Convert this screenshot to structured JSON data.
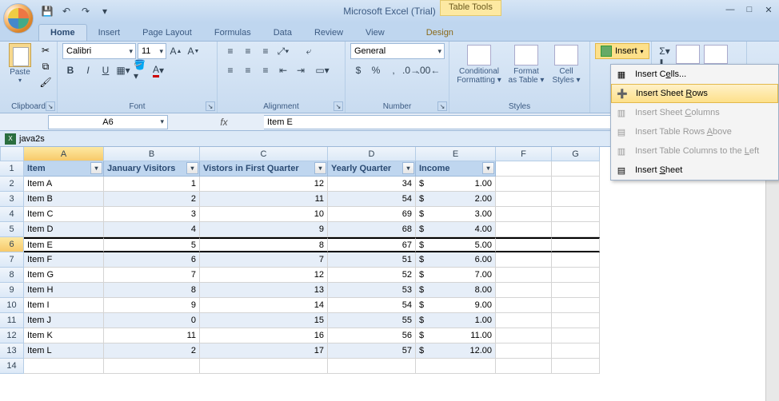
{
  "title": "Microsoft Excel (Trial)",
  "context_tab": "Table Tools",
  "tabs": [
    "Home",
    "Insert",
    "Page Layout",
    "Formulas",
    "Data",
    "Review",
    "View",
    "Design"
  ],
  "active_tab": "Home",
  "qat": {
    "save": "save",
    "undo": "↶",
    "redo": "↷"
  },
  "clipboard": {
    "paste": "Paste",
    "label": "Clipboard"
  },
  "font": {
    "name": "Calibri",
    "size": "11",
    "grow": "A",
    "shrink": "A",
    "bold": "B",
    "italic": "I",
    "underline": "U",
    "label": "Font"
  },
  "align": {
    "label": "Alignment"
  },
  "number": {
    "format": "General",
    "label": "Number",
    "currency": "$",
    "percent": "%",
    "comma": ","
  },
  "styles": {
    "cond": "Conditional",
    "cond2": "Formatting",
    "fmt": "Format",
    "fmt2": "as Table",
    "cell": "Cell",
    "cell2": "Styles",
    "label": "Styles"
  },
  "cells": {
    "insert": "Insert"
  },
  "editing": {
    "sigma": "Σ"
  },
  "insert_menu": {
    "cells": "Insert Cells...",
    "rows": "Insert Sheet Rows",
    "cols": "Insert Sheet Columns",
    "tblrows": "Insert Table Rows Above",
    "tblcols": "Insert Table Columns to the Left",
    "sheet": "Insert Sheet"
  },
  "namebox": "A6",
  "formula": "Item E",
  "workbook": "java2s",
  "columns": [
    "A",
    "B",
    "C",
    "D",
    "E",
    "F",
    "G"
  ],
  "table": {
    "headers": [
      "Item",
      "January Visitors",
      "Vistors in First Quarter",
      "Yearly Quarter",
      "Income"
    ],
    "rows": [
      {
        "n": 2,
        "item": "Item A",
        "jan": "1",
        "q": "12",
        "yq": "34",
        "cur": "$",
        "inc": "1.00",
        "band": false
      },
      {
        "n": 3,
        "item": "Item B",
        "jan": "2",
        "q": "11",
        "yq": "54",
        "cur": "$",
        "inc": "2.00",
        "band": true
      },
      {
        "n": 4,
        "item": "Item C",
        "jan": "3",
        "q": "10",
        "yq": "69",
        "cur": "$",
        "inc": "3.00",
        "band": false
      },
      {
        "n": 5,
        "item": "Item D",
        "jan": "4",
        "q": "9",
        "yq": "68",
        "cur": "$",
        "inc": "4.00",
        "band": true
      },
      {
        "n": 6,
        "item": "Item E",
        "jan": "5",
        "q": "8",
        "yq": "67",
        "cur": "$",
        "inc": "5.00",
        "band": false,
        "selected": true
      },
      {
        "n": 7,
        "item": "Item F",
        "jan": "6",
        "q": "7",
        "yq": "51",
        "cur": "$",
        "inc": "6.00",
        "band": true
      },
      {
        "n": 8,
        "item": "Item G",
        "jan": "7",
        "q": "12",
        "yq": "52",
        "cur": "$",
        "inc": "7.00",
        "band": false
      },
      {
        "n": 9,
        "item": "Item H",
        "jan": "8",
        "q": "13",
        "yq": "53",
        "cur": "$",
        "inc": "8.00",
        "band": true
      },
      {
        "n": 10,
        "item": "Item I",
        "jan": "9",
        "q": "14",
        "yq": "54",
        "cur": "$",
        "inc": "9.00",
        "band": false
      },
      {
        "n": 11,
        "item": "Item J",
        "jan": "0",
        "q": "15",
        "yq": "55",
        "cur": "$",
        "inc": "1.00",
        "band": true
      },
      {
        "n": 12,
        "item": "Item K",
        "jan": "11",
        "q": "16",
        "yq": "56",
        "cur": "$",
        "inc": "11.00",
        "band": false
      },
      {
        "n": 13,
        "item": "Item L",
        "jan": "2",
        "q": "17",
        "yq": "57",
        "cur": "$",
        "inc": "12.00",
        "band": true
      }
    ]
  }
}
